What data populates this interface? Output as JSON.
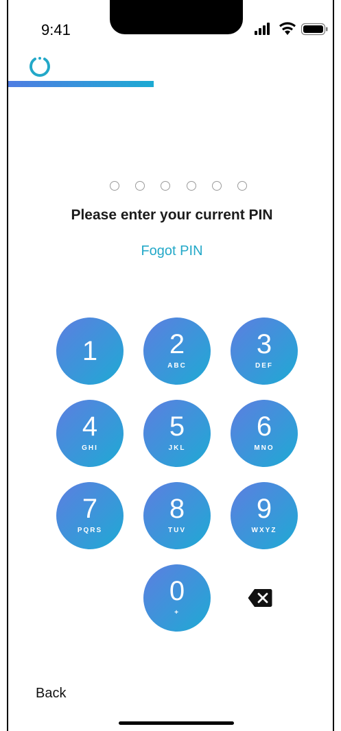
{
  "status_bar": {
    "time": "9:41",
    "icons": [
      "signal-icon",
      "wifi-icon",
      "battery-icon"
    ]
  },
  "brand": {
    "icon": "loading-ring-icon",
    "accent": "#23a8c8"
  },
  "progress": {
    "fraction": 0.5
  },
  "pin": {
    "length": 6,
    "filled": 0
  },
  "title": "Please enter your current PIN",
  "forgot_link": "Fogot PIN",
  "keypad": {
    "keys": [
      {
        "digit": "1",
        "letters": ""
      },
      {
        "digit": "2",
        "letters": "ABC"
      },
      {
        "digit": "3",
        "letters": "DEF"
      },
      {
        "digit": "4",
        "letters": "GHI"
      },
      {
        "digit": "5",
        "letters": "JKL"
      },
      {
        "digit": "6",
        "letters": "MNO"
      },
      {
        "digit": "7",
        "letters": "PQRS"
      },
      {
        "digit": "8",
        "letters": "TUV"
      },
      {
        "digit": "9",
        "letters": "WXYZ"
      },
      {
        "digit": "0",
        "letters": "+"
      }
    ],
    "backspace_icon": "backspace-icon"
  },
  "back_label": "Back",
  "colors": {
    "gradient_start": "#5d7ee0",
    "gradient_end": "#1eaad4",
    "text": "#1b1b1b"
  }
}
